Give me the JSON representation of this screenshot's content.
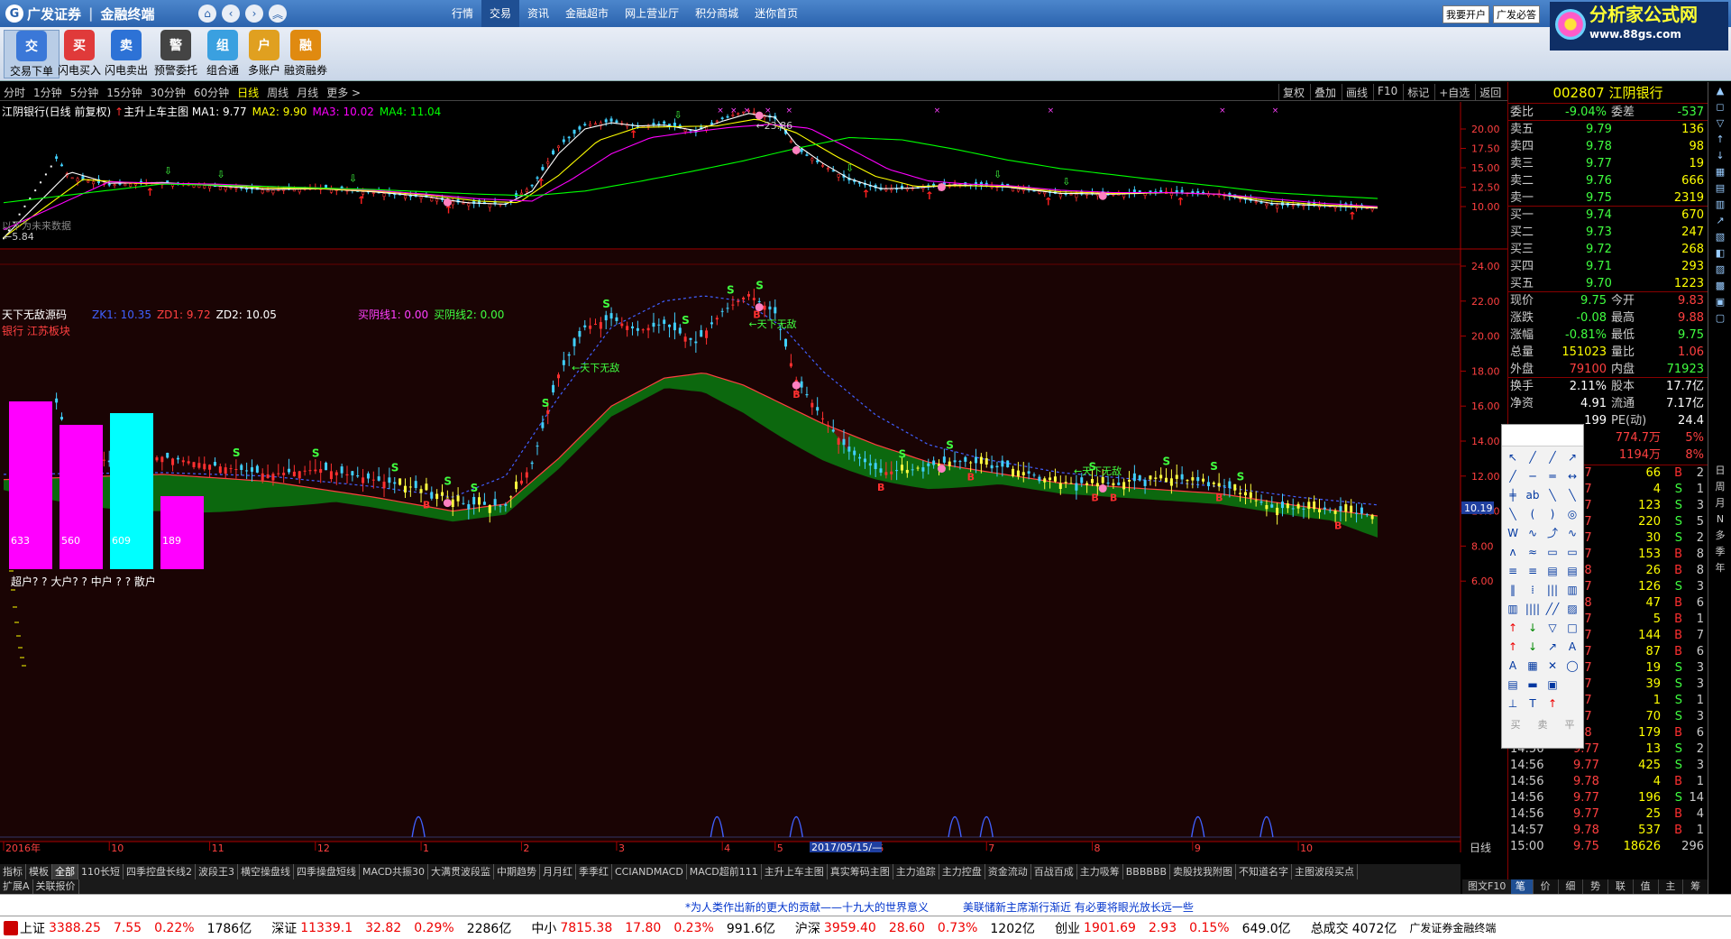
{
  "titlebar": {
    "brand_name": "广发证券",
    "product_name": "金融终端",
    "logo_glyph": "G",
    "nav_icons": [
      "home-icon",
      "back-icon",
      "forward-icon",
      "collapse-icon"
    ],
    "nav_glyphs": [
      "⌂",
      "‹",
      "›",
      "︽"
    ],
    "menu": [
      "行情",
      "交易",
      "资讯",
      "金融超市",
      "网上营业厅",
      "积分商城",
      "迷你首页"
    ],
    "active_menu": "交易",
    "right_buttons": [
      "我要开户",
      "广发必答"
    ],
    "watermark_title": "分析家公式网",
    "watermark_url": "www.88gs.com"
  },
  "toolbar": {
    "buttons": [
      {
        "label": "交易下单",
        "icon": "trade-order-icon",
        "glyph": "交",
        "color": "#3b78d8"
      },
      {
        "label": "闪电买入",
        "icon": "buy-icon",
        "glyph": "买",
        "color": "#e03a3a"
      },
      {
        "label": "闪电卖出",
        "icon": "sell-icon",
        "glyph": "卖",
        "color": "#2d72d6"
      },
      {
        "label": "预警委托",
        "icon": "alert-icon",
        "glyph": "警",
        "color": "#444"
      },
      {
        "label": "组合通",
        "icon": "portfolio-icon",
        "glyph": "组",
        "color": "#3aa0e0"
      },
      {
        "label": "多账户",
        "icon": "multi-account-icon",
        "glyph": "户",
        "color": "#e0a020"
      },
      {
        "label": "融资融券",
        "icon": "margin-icon",
        "glyph": "融",
        "color": "#e08a10"
      }
    ]
  },
  "periods": {
    "items": [
      "分时",
      "1分钟",
      "5分钟",
      "15分钟",
      "30分钟",
      "60分钟",
      "日线",
      "周线",
      "月线",
      "更多 >"
    ],
    "active": "日线",
    "chart_buttons": [
      "复权",
      "叠加",
      "画线",
      "F10",
      "标记",
      "+自选",
      "返回"
    ]
  },
  "indicators": {
    "main_title": "江阴银行(日线 前复权)",
    "main_formula": "主升上车主图",
    "ma": [
      {
        "label": "MA1: 9.77",
        "color": "#ffffff"
      },
      {
        "label": "MA2: 9.90",
        "color": "#ffff00"
      },
      {
        "label": "MA3: 10.02",
        "color": "#ff00ff"
      },
      {
        "label": "MA4: 11.04",
        "color": "#00ff00"
      }
    ],
    "main_peak": "23.86",
    "main_low": "5.84",
    "main_note": "以下为未来数据",
    "sub_title": "天下无敌源码",
    "sub_values": [
      {
        "label": "ZK1: 10.35",
        "color": "#4060ff"
      },
      {
        "label": "ZD1: 9.72",
        "color": "#ff4040"
      },
      {
        "label": "ZD2: 10.05",
        "color": "#ffffff"
      },
      {
        "label": "买阴线1: 0.00",
        "color": "#ff40ff"
      },
      {
        "label": "买阴线2: 0.00",
        "color": "#40ff40"
      }
    ],
    "sub_subtitle": "银行 江苏板块",
    "sub_text_label": "天下无敌",
    "sub_last_value": "10.19",
    "date_label": "2017/05/15/—",
    "kline_axis": "日线",
    "corner_buttons": [
      "+",
      "-",
      "0"
    ]
  },
  "investor_bars": {
    "categories": [
      "超户",
      "大户",
      "中户",
      "散户"
    ],
    "values": [
      633,
      560,
      609,
      189
    ],
    "legend_text": "超户? ? 大户? ? 中户 ? ? 散户",
    "colors": [
      "#ff00ff",
      "#ff00ff",
      "#00ffff",
      "#ff00ff"
    ]
  },
  "chart_data": {
    "type": "line",
    "axes": {
      "main_y_ticks": [
        "20.00",
        "17.50",
        "15.00",
        "12.50",
        "10.00"
      ],
      "main_y_ticks_num": [
        20,
        17.5,
        15,
        12.5,
        10
      ],
      "main_ylim": [
        5.0,
        25.0
      ],
      "sub_y_ticks": [
        "24.00",
        "22.00",
        "20.00",
        "18.00",
        "16.00",
        "14.00",
        "12.00",
        "10.00",
        "8.00",
        "6.00"
      ],
      "sub_y_ticks_num": [
        24,
        22,
        20,
        18,
        16,
        14,
        12,
        10,
        8,
        6
      ],
      "sub_ylim": [
        4.0,
        24.5
      ],
      "x_labels": [
        "2016年",
        "10",
        "11",
        "12",
        "1",
        "2",
        "3",
        "4",
        "5",
        "6",
        "7",
        "8",
        "9",
        "10"
      ],
      "x_label_pos": [
        0,
        40,
        78,
        118,
        158,
        196,
        232,
        272,
        292,
        330,
        372,
        412,
        450,
        490
      ]
    },
    "n_days": 520,
    "close_series": {
      "x": [
        0,
        20,
        25,
        40,
        60,
        80,
        100,
        120,
        140,
        160,
        175,
        190,
        200,
        210,
        220,
        230,
        240,
        250,
        262,
        272,
        282,
        292,
        300,
        310,
        320,
        332,
        345,
        360,
        380,
        400,
        420,
        440,
        460,
        480,
        500,
        520
      ],
      "y": [
        5.9,
        16.2,
        13.8,
        12.8,
        13.1,
        12.6,
        12.1,
        12.4,
        11.8,
        11.2,
        10.4,
        10.3,
        12.7,
        17.8,
        20.5,
        21.0,
        20.3,
        20.7,
        19.6,
        21.4,
        22.4,
        21.3,
        17.5,
        15.3,
        13.4,
        12.2,
        12.4,
        12.9,
        12.5,
        11.6,
        11.6,
        11.9,
        11.6,
        10.2,
        10.1,
        9.75
      ]
    },
    "series": [
      {
        "name": "MA1",
        "color": "#ffffff",
        "x": [
          0,
          25,
          40,
          60,
          80,
          100,
          120,
          140,
          160,
          175,
          190,
          200,
          210,
          220,
          230,
          240,
          250,
          262,
          272,
          282,
          292,
          300,
          310,
          320,
          332,
          345,
          360,
          380,
          400,
          420,
          440,
          460,
          480,
          500,
          520
        ],
        "y": [
          6.0,
          14.5,
          13.0,
          13.1,
          12.7,
          12.2,
          12.3,
          11.9,
          11.3,
          10.5,
          10.3,
          12.0,
          16.8,
          20.0,
          20.8,
          20.4,
          20.5,
          19.8,
          21.0,
          22.0,
          21.5,
          18.0,
          15.6,
          13.6,
          12.3,
          12.4,
          12.8,
          12.5,
          11.7,
          11.6,
          11.8,
          11.6,
          10.4,
          10.1,
          9.8
        ]
      },
      {
        "name": "MA2",
        "color": "#ffff00",
        "x": [
          0,
          30,
          50,
          80,
          100,
          120,
          140,
          160,
          180,
          195,
          210,
          225,
          240,
          255,
          270,
          285,
          300,
          315,
          330,
          345,
          360,
          380,
          400,
          420,
          440,
          460,
          480,
          500,
          520
        ],
        "y": [
          6.0,
          13.5,
          13.0,
          12.8,
          12.4,
          12.3,
          12.0,
          11.5,
          10.7,
          10.5,
          14.0,
          18.5,
          20.2,
          20.3,
          20.4,
          21.3,
          19.5,
          16.5,
          13.9,
          12.6,
          12.7,
          12.6,
          11.9,
          11.7,
          11.8,
          11.6,
          10.7,
          10.2,
          9.9
        ]
      },
      {
        "name": "MA3",
        "color": "#ff00ff",
        "x": [
          0,
          40,
          60,
          80,
          100,
          120,
          140,
          160,
          180,
          200,
          215,
          230,
          245,
          260,
          275,
          290,
          305,
          320,
          335,
          350,
          365,
          380,
          400,
          420,
          440,
          460,
          480,
          500,
          520
        ],
        "y": [
          7.0,
          13.2,
          13.0,
          12.9,
          12.6,
          12.4,
          12.1,
          11.6,
          11.0,
          10.7,
          13.5,
          16.8,
          18.9,
          19.6,
          20.2,
          20.6,
          20.1,
          17.5,
          14.8,
          13.3,
          12.9,
          12.7,
          12.1,
          11.8,
          11.8,
          11.6,
          11.0,
          10.4,
          10.0
        ]
      },
      {
        "name": "MA4",
        "color": "#00ff00",
        "x": [
          0,
          60,
          100,
          140,
          180,
          200,
          220,
          240,
          260,
          280,
          300,
          320,
          340,
          360,
          380,
          400,
          420,
          440,
          460,
          480,
          500,
          520
        ],
        "y": [
          10.5,
          12.9,
          12.6,
          12.2,
          11.6,
          11.4,
          12.0,
          13.2,
          14.5,
          15.9,
          17.5,
          18.9,
          18.6,
          17.4,
          16.0,
          14.9,
          14.1,
          13.3,
          12.6,
          11.8,
          11.4,
          11.04
        ]
      },
      {
        "name": "ZK1",
        "color": "#4060ff",
        "x": [
          0,
          60,
          100,
          140,
          170,
          190,
          210,
          230,
          250,
          265,
          280,
          295,
          310,
          330,
          350,
          370,
          400,
          430,
          460,
          490,
          520
        ],
        "y": [
          12.1,
          12.2,
          12.0,
          11.4,
          10.8,
          12.0,
          16.5,
          20.5,
          22.0,
          22.3,
          22.0,
          20.5,
          18.0,
          15.5,
          13.8,
          13.0,
          12.2,
          11.8,
          11.4,
          10.8,
          10.35
        ]
      },
      {
        "name": "ZD1",
        "color": "#ff4040",
        "x": [
          0,
          60,
          100,
          140,
          170,
          190,
          210,
          230,
          250,
          265,
          280,
          295,
          310,
          330,
          350,
          370,
          400,
          430,
          460,
          490,
          520
        ],
        "y": [
          11.8,
          12.1,
          11.7,
          10.8,
          10.0,
          10.4,
          13.0,
          16.0,
          17.6,
          17.9,
          17.2,
          16.1,
          15.0,
          13.8,
          12.8,
          12.3,
          11.6,
          11.3,
          11.0,
          10.3,
          9.72
        ]
      },
      {
        "name": "ZD2",
        "color": "#ffffff",
        "x": [
          0,
          520
        ],
        "y": [
          10.05,
          10.05
        ]
      }
    ],
    "signals": {
      "buy_arrow_x": [
        55,
        135,
        168,
        203,
        238,
        326,
        350,
        395,
        445,
        510
      ],
      "down_arrow_x": [
        62,
        82,
        132,
        255,
        320,
        376,
        402
      ],
      "pink_dot_x": [
        168,
        286,
        300,
        355,
        416
      ],
      "s_labels_x": [
        88,
        118,
        148,
        168,
        178,
        205,
        228,
        258,
        275,
        286,
        340,
        358,
        412,
        440,
        458,
        468
      ],
      "b_labels_x": [
        160,
        285,
        300,
        332,
        366,
        413,
        420,
        460,
        505
      ]
    },
    "bottom_peaks_x": [
      157,
      270,
      300,
      360,
      372,
      452,
      478
    ]
  },
  "right_panel": {
    "stock_code": "002807",
    "stock_name": "江阴银行",
    "weibi": {
      "label": "委比",
      "value": "-9.04%",
      "label2": "委差",
      "value2": "-537"
    },
    "sell": [
      {
        "label": "卖五",
        "price": "9.79",
        "vol": "136"
      },
      {
        "label": "卖四",
        "price": "9.78",
        "vol": "98"
      },
      {
        "label": "卖三",
        "price": "9.77",
        "vol": "19"
      },
      {
        "label": "卖二",
        "price": "9.76",
        "vol": "666"
      },
      {
        "label": "卖一",
        "price": "9.75",
        "vol": "2319"
      }
    ],
    "buy": [
      {
        "label": "买一",
        "price": "9.74",
        "vol": "670"
      },
      {
        "label": "买二",
        "price": "9.73",
        "vol": "247"
      },
      {
        "label": "买三",
        "price": "9.72",
        "vol": "268"
      },
      {
        "label": "买四",
        "price": "9.71",
        "vol": "293"
      },
      {
        "label": "买五",
        "price": "9.70",
        "vol": "1223"
      }
    ],
    "quote": [
      {
        "l": "现价",
        "v": "9.75",
        "l2": "今开",
        "v2": "9.83",
        "c": "#40ff40",
        "c2": "#ff4040"
      },
      {
        "l": "涨跌",
        "v": "-0.08",
        "l2": "最高",
        "v2": "9.88",
        "c": "#40ff40",
        "c2": "#ff4040"
      },
      {
        "l": "涨幅",
        "v": "-0.81%",
        "l2": "最低",
        "v2": "9.75",
        "c": "#40ff40",
        "c2": "#40ff40"
      },
      {
        "l": "总量",
        "v": "151023",
        "l2": "量比",
        "v2": "1.06",
        "c": "#ffff00",
        "c2": "#ff4040"
      },
      {
        "l": "外盘",
        "v": "79100",
        "l2": "内盘",
        "v2": "71923",
        "c": "#ff4040",
        "c2": "#40ff40"
      }
    ],
    "quote2": [
      {
        "l": "换手",
        "v": "2.11%",
        "l2": "股本",
        "v2": "17.7亿",
        "c": "#ffffff",
        "c2": "#ffffff"
      },
      {
        "l": "净资",
        "v": "4.91",
        "l2": "流通",
        "v2": "7.17亿",
        "c": "#ffffff",
        "c2": "#ffffff"
      },
      {
        "l": "",
        "v": "199",
        "l2": "PE(动)",
        "v2": "24.4",
        "c": "#ffffff",
        "c2": "#ffffff"
      }
    ],
    "flow": [
      {
        "v": "774.7万",
        "p": "5%"
      },
      {
        "v": "1194万",
        "p": "8%"
      }
    ],
    "ticks": [
      {
        "t": "",
        "p": ".77",
        "v": "66",
        "bs": "B",
        "n": "2"
      },
      {
        "t": "",
        "p": ".77",
        "v": "4",
        "bs": "S",
        "n": "1"
      },
      {
        "t": "",
        "p": ".77",
        "v": "123",
        "bs": "S",
        "n": "3"
      },
      {
        "t": "",
        "p": ".77",
        "v": "220",
        "bs": "S",
        "n": "5"
      },
      {
        "t": "",
        "p": ".77",
        "v": "30",
        "bs": "S",
        "n": "2"
      },
      {
        "t": "",
        "p": ".77",
        "v": "153",
        "bs": "B",
        "n": "8"
      },
      {
        "t": "",
        "p": ".78",
        "v": "26",
        "bs": "B",
        "n": "8"
      },
      {
        "t": "",
        "p": ".77",
        "v": "126",
        "bs": "S",
        "n": "3"
      },
      {
        "t": "",
        "p": ".78",
        "v": "47",
        "bs": "B",
        "n": "6"
      },
      {
        "t": "",
        "p": ".77",
        "v": "5",
        "bs": "B",
        "n": "1"
      },
      {
        "t": "",
        "p": ".77",
        "v": "144",
        "bs": "B",
        "n": "7"
      },
      {
        "t": "",
        "p": ".77",
        "v": "87",
        "bs": "B",
        "n": "6"
      },
      {
        "t": "",
        "p": ".77",
        "v": "19",
        "bs": "S",
        "n": "3"
      },
      {
        "t": "",
        "p": ".77",
        "v": "39",
        "bs": "S",
        "n": "3"
      },
      {
        "t": "",
        "p": ".77",
        "v": "1",
        "bs": "S",
        "n": "1"
      },
      {
        "t": "",
        "p": ".77",
        "v": "70",
        "bs": "S",
        "n": "3"
      },
      {
        "t": "",
        "p": ".78",
        "v": "179",
        "bs": "B",
        "n": "6"
      },
      {
        "t": "14:56",
        "p": "9.77",
        "v": "13",
        "bs": "S",
        "n": "2"
      },
      {
        "t": "14:56",
        "p": "9.77",
        "v": "425",
        "bs": "S",
        "n": "3"
      },
      {
        "t": "14:56",
        "p": "9.78",
        "v": "4",
        "bs": "B",
        "n": "1"
      },
      {
        "t": "14:56",
        "p": "9.77",
        "v": "196",
        "bs": "S",
        "n": "14"
      },
      {
        "t": "14:56",
        "p": "9.77",
        "v": "25",
        "bs": "B",
        "n": "4"
      },
      {
        "t": "14:57",
        "p": "9.78",
        "v": "537",
        "bs": "B",
        "n": "1"
      },
      {
        "t": "15:00",
        "p": "9.75",
        "v": "18626",
        "bs": "",
        "n": "296"
      }
    ],
    "tabs": [
      "笔",
      "价",
      "细",
      "势",
      "联",
      "值",
      "主",
      "筹"
    ],
    "active_tab": "笔"
  },
  "iconstrip": [
    "日",
    "周",
    "月",
    "N",
    "多",
    "季",
    "年"
  ],
  "palette": {
    "tools": [
      "↖",
      "╱",
      "╱",
      "↗",
      "╱",
      "─",
      "═",
      "↔",
      "╪",
      "ab",
      "╲",
      "╲",
      "╲",
      "(",
      ")",
      "◎",
      "W",
      "∿",
      "⤴",
      "∿",
      "ʌ",
      "≈",
      "▭",
      "▭",
      "≡",
      "≡",
      "▤",
      "▤",
      "‖",
      "⁞",
      "|||",
      "▥",
      "▥",
      "||||",
      "╱╱",
      "▨",
      "↑",
      "↓",
      "▽",
      "□",
      "↑",
      "↓",
      "↗",
      "A",
      "A",
      "▦",
      "✕",
      "◯",
      "▤",
      "▬",
      "▣",
      "",
      "⊥",
      "T",
      "↑",
      ""
    ],
    "foot": [
      "买",
      "卖",
      "平"
    ]
  },
  "tabs": {
    "row1": [
      "指标",
      "模板",
      "全部",
      "110长短",
      "四季控盘长线2",
      "波段王3",
      "横空操盘线",
      "四季操盘短线",
      "MACD共振30",
      "大满贯波段监",
      "中期趋势",
      "月月红",
      "季季红",
      "CCIANDMACD",
      "MACD超前111",
      "主升上车主图",
      "真实筹码主图",
      "主力追踪",
      "主力控盘",
      "资金流动",
      "百战百成",
      "主力吸筹",
      "BBBBBB",
      "卖股找我附图",
      "不知道名字",
      "主图波段买点"
    ],
    "row1_active": "全部",
    "row2": [
      "扩展A",
      "关联报价"
    ],
    "corner": "图文F10"
  },
  "news": {
    "n1": "*为人类作出新的更大的贡献——十九大的世界意义",
    "n2": "美联储新主席渐行渐近 有必要将眼光放长远一些"
  },
  "status": [
    {
      "name": "上证",
      "price": "3388.25",
      "chg": "7.55",
      "pct": "0.22%",
      "amt": "1786亿"
    },
    {
      "name": "深证",
      "price": "11339.1",
      "chg": "32.82",
      "pct": "0.29%",
      "amt": "2286亿"
    },
    {
      "name": "中小",
      "price": "7815.38",
      "chg": "17.80",
      "pct": "0.23%",
      "amt": "991.6亿"
    },
    {
      "name": "沪深",
      "price": "3959.40",
      "chg": "28.60",
      "pct": "0.73%",
      "amt": "1202亿"
    },
    {
      "name": "创业",
      "price": "1901.69",
      "chg": "2.93",
      "pct": "0.15%",
      "amt": "649.0亿"
    }
  ],
  "status_total": {
    "label": "总成交",
    "amt": "4072亿",
    "app": "广发证券金融终端"
  }
}
